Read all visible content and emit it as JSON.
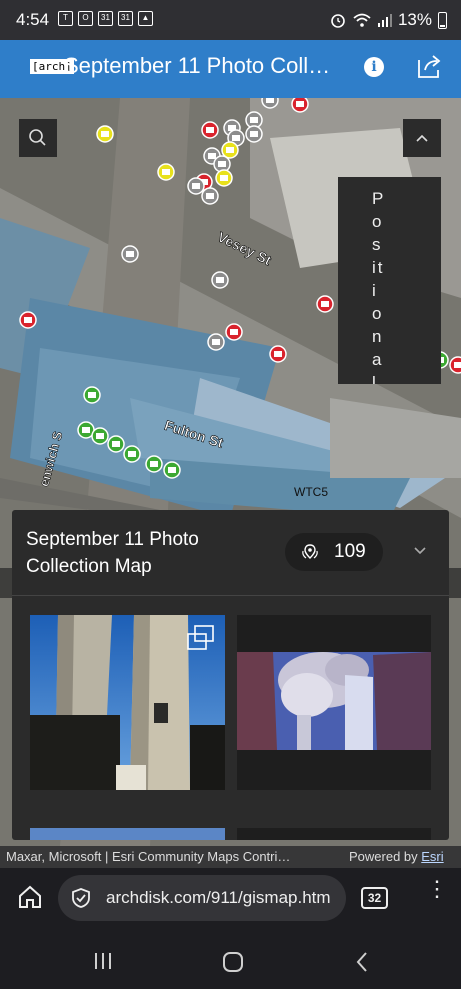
{
  "status_bar": {
    "time": "4:54",
    "battery": "13%",
    "notification_icons": [
      "teams-icon",
      "outlook-icon",
      "calendar-icon",
      "calendar-icon",
      "gallery-icon"
    ]
  },
  "header": {
    "logo_text": "[arch]",
    "title": "September 11 Photo Coll…"
  },
  "map": {
    "street_labels": [
      "Vesey St",
      "Fulton St",
      "enwich S",
      "WTC5"
    ],
    "position_panel_text": "Positional C"
  },
  "card": {
    "title": "September 11 Photo Collection Map",
    "count": "109"
  },
  "attribution": {
    "text": "Maxar, Microsoft | Esri Community Maps Contri…",
    "powered_by": "Powered by ",
    "esri": "Esri"
  },
  "browser": {
    "url": "archdisk.com/911/gismap.htm",
    "tab_count": "32"
  },
  "colors": {
    "header_blue": "#2f7ec9",
    "marker_red": "#d9232d",
    "marker_yellow": "#e8e11c",
    "marker_green": "#3ca832",
    "marker_gray": "#8c8c8c"
  }
}
